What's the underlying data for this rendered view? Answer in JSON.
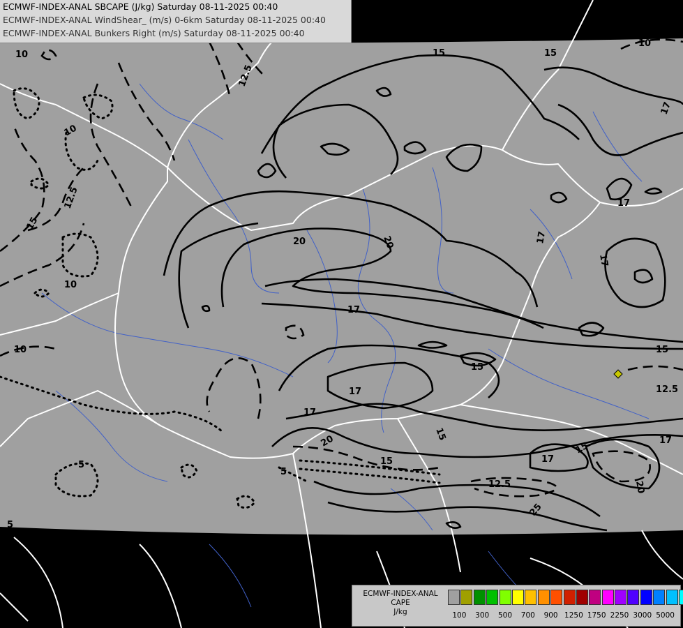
{
  "titles": [
    "ECMWF-INDEX-ANAL SBCAPE (J/kg) Saturday 08-11-2025 00:40",
    "ECMWF-INDEX-ANAL WindShear_ (m/s) 0-6km Saturday 08-11-2025 00:40",
    "ECMWF-INDEX-ANAL Bunkers Right (m/s) Saturday 08-11-2025 00:40"
  ],
  "legend": {
    "line1": "ECMWF-INDEX-ANAL",
    "line2": "CAPE",
    "line3": "J/kg",
    "colors": [
      "#a0a0a0",
      "#a0a000",
      "#009000",
      "#00c000",
      "#80ff00",
      "#ffff00",
      "#ffc000",
      "#ff9000",
      "#ff5000",
      "#d02000",
      "#a00000",
      "#c00080",
      "#ff00ff",
      "#a000ff",
      "#5000ff",
      "#0000ff",
      "#0080ff",
      "#00c0ff",
      "#00ffff",
      "#80ffff",
      "#ffffff"
    ],
    "ticks": [
      "100",
      "300",
      "500",
      "700",
      "900",
      "1250",
      "1750",
      "2250",
      "3000",
      "5000"
    ]
  },
  "contour_labels": [
    "10",
    "12.5",
    "15",
    "17",
    "20",
    "25",
    "5"
  ],
  "map": {
    "domain_color": "#a0a0a0",
    "outside_color": "#000000",
    "border_color": "#ffffff",
    "river_color": "#4060c8"
  }
}
